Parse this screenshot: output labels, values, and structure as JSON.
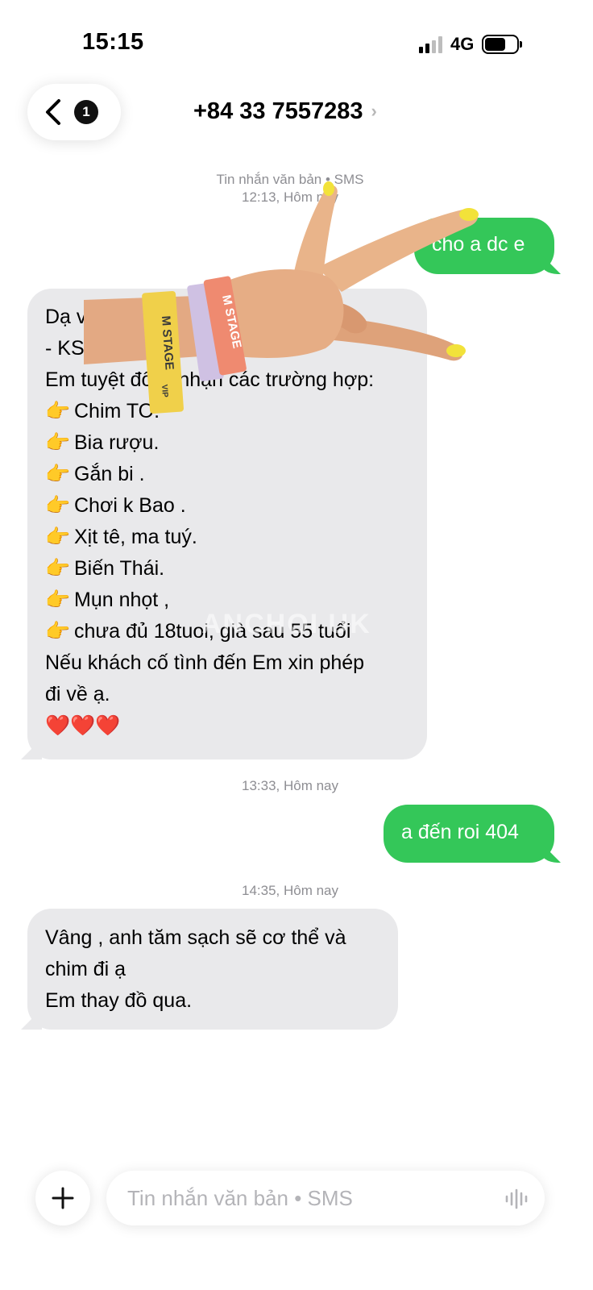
{
  "status_bar": {
    "time": "15:15",
    "network": "4G"
  },
  "header": {
    "unread_count": "1",
    "contact": "+84 33 7557283",
    "chevron": "›"
  },
  "messages": [
    {
      "type": "stamp",
      "lines": [
        "Tin nhắn văn bản • SMS",
        "12:13, Hôm nay"
      ]
    },
    {
      "type": "out",
      "text": "cho a dc e"
    },
    {
      "type": "in",
      "lines": [
        "Dạ v",
        "- KS",
        "Em tuyệt đối k nhận các trường hợp:",
        "Chim TO.",
        "Bia rượu.",
        "Gắn bi .",
        "Chơi k Bao .",
        "Xịt tê, ma tuý.",
        "Biến Thái.",
        "Mụn nhọt ,",
        "chưa đủ 18tuoi, già sau 55 tuổi",
        "Nếu khách cố tình đến Em xin phép",
        "đi về ạ.",
        "❤️❤️❤️"
      ],
      "bullet_emoji": "👉",
      "watermark": "ANCHOI.UK"
    },
    {
      "type": "stamp",
      "lines": [
        "13:33, Hôm nay"
      ]
    },
    {
      "type": "out",
      "text": "a đến roi 404"
    },
    {
      "type": "stamp",
      "lines": [
        "14:35, Hôm nay"
      ]
    },
    {
      "type": "in",
      "lines": [
        "Vâng , anh tăm sạch sẽ cơ thể và",
        "chim đi ạ",
        "Em thay đồ qua."
      ]
    }
  ],
  "overlay": {
    "wristband_text_1": "M STAGE",
    "wristband_vip": "VIP",
    "wristband_text_2": "M STAGE"
  },
  "composer": {
    "placeholder": "Tin nhắn văn bản • SMS"
  },
  "colors": {
    "outgoing": "#34c759",
    "incoming": "#e9e9eb",
    "timestamp": "#8e8e93"
  }
}
